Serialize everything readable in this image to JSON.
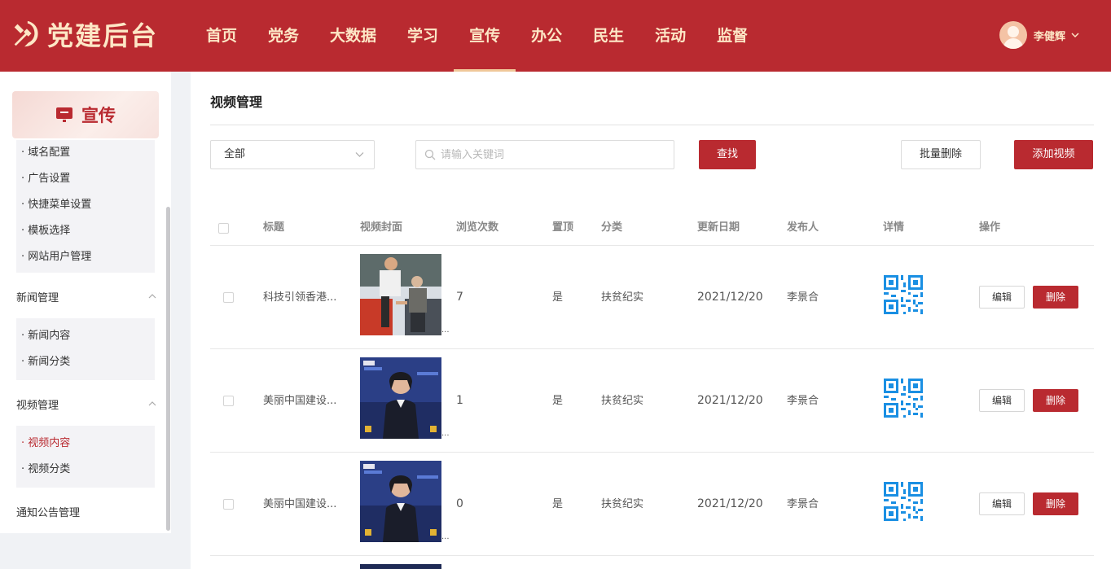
{
  "app": {
    "logo_text": "党建后台",
    "brand_color": "#b92a30"
  },
  "nav": {
    "items": [
      {
        "label": "首页"
      },
      {
        "label": "党务"
      },
      {
        "label": "大数据"
      },
      {
        "label": "学习"
      },
      {
        "label": "宣传",
        "active": true
      },
      {
        "label": "办公"
      },
      {
        "label": "民生"
      },
      {
        "label": "活动"
      },
      {
        "label": "监督"
      }
    ]
  },
  "user": {
    "name": "李健辉",
    "avatar_icon": "avatar-icon",
    "caret_icon": "chevron-down-icon"
  },
  "sidebar": {
    "banner_label": "宣传",
    "banner_icon": "monitor-icon",
    "group_site": {
      "items": [
        "域名配置",
        "广告设置",
        "快捷菜单设置",
        "模板选择",
        "网站用户管理"
      ]
    },
    "news": {
      "title": "新闻管理",
      "items": [
        "新闻内容",
        "新闻分类"
      ]
    },
    "video": {
      "title": "视频管理",
      "items": [
        "视频内容",
        "视频分类"
      ],
      "active_item": "视频内容"
    },
    "notice": {
      "title": "通知公告管理"
    }
  },
  "main": {
    "page_title": "视频管理",
    "filter_select": {
      "value": "全部"
    },
    "search": {
      "placeholder": "请输入关键词",
      "value": ""
    },
    "buttons": {
      "find": "查找",
      "batch_delete": "批量删除",
      "add_video": "添加视频"
    },
    "table": {
      "headers": {
        "title": "标题",
        "cover": "视频封面",
        "views": "浏览次数",
        "pinned": "置顶",
        "category": "分类",
        "updated": "更新日期",
        "publisher": "发布人",
        "detail": "详情",
        "actions": "操作"
      },
      "rows": [
        {
          "title": "科技引领香港...",
          "views": "7",
          "pinned": "是",
          "category": "扶贫纪实",
          "updated": "2021/12/20",
          "publisher": "李景合",
          "edit": "编辑",
          "delete": "删除",
          "cover_ellipsis": "..."
        },
        {
          "title": "美丽中国建设...",
          "views": "1",
          "pinned": "是",
          "category": "扶贫纪实",
          "updated": "2021/12/20",
          "publisher": "李景合",
          "edit": "编辑",
          "delete": "删除",
          "cover_ellipsis": "..."
        },
        {
          "title": "美丽中国建设...",
          "views": "0",
          "pinned": "是",
          "category": "扶贫纪实",
          "updated": "2021/12/20",
          "publisher": "李景合",
          "edit": "编辑",
          "delete": "删除",
          "cover_ellipsis": "..."
        }
      ]
    }
  },
  "colors": {
    "header_bg": "#b92a30",
    "qr_blue": "#1a8fe3",
    "active_text": "#b92a30"
  }
}
